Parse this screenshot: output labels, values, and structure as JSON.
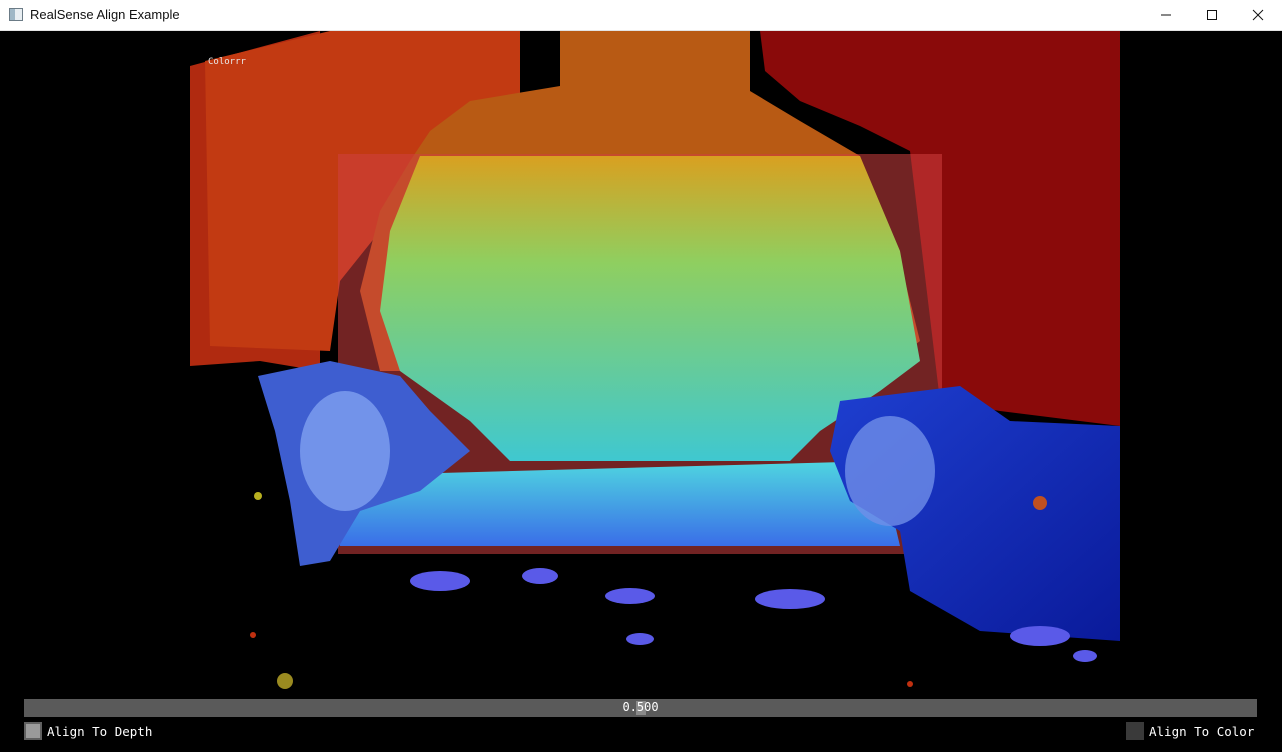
{
  "window": {
    "title": "RealSense Align Example",
    "app_icon": "window-app-icon",
    "controls": [
      "minimize-icon",
      "maximize-icon",
      "close-icon"
    ]
  },
  "view": {
    "stream_label": "Colorrr",
    "description_colors": {
      "background": "#000000",
      "depth_far": "#8b0000",
      "depth_mid": "#e8d030",
      "depth_near": "#1030c0"
    }
  },
  "slider": {
    "value": "0.500",
    "fraction": 0.5
  },
  "options": {
    "align_to_depth": {
      "label": "Align To Depth",
      "checked": true
    },
    "align_to_color": {
      "label": "Align To Color",
      "checked": false
    }
  }
}
